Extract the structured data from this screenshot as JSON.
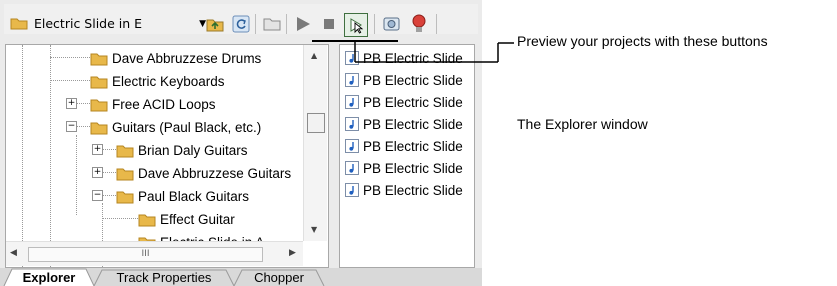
{
  "toolbar": {
    "folder_combo_value": "Electric Slide in E"
  },
  "tree": {
    "items": [
      {
        "label": "Dave Abbruzzese Drums"
      },
      {
        "label": "Electric Keyboards"
      },
      {
        "label": "Free ACID Loops",
        "expander": "+"
      },
      {
        "label": "Guitars (Paul Black, etc.)",
        "expander": "−"
      },
      {
        "label": "Brian Daly Guitars",
        "expander": "+"
      },
      {
        "label": "Dave Abbruzzese Guitars",
        "expander": "+"
      },
      {
        "label": "Paul Black Guitars",
        "expander": "−"
      },
      {
        "label": "Effect Guitar"
      },
      {
        "label": "Electric Slide in A"
      }
    ],
    "hscroll_thumb_label": "III"
  },
  "files": {
    "items": [
      {
        "label": "PB Electric Slide"
      },
      {
        "label": "PB Electric Slide"
      },
      {
        "label": "PB Electric Slide"
      },
      {
        "label": "PB Electric Slide"
      },
      {
        "label": "PB Electric Slide"
      },
      {
        "label": "PB Electric Slide"
      },
      {
        "label": "PB Electric Slide"
      }
    ]
  },
  "tabs": [
    {
      "label": "Explorer",
      "active": true
    },
    {
      "label": "Track Properties"
    },
    {
      "label": "Chopper"
    }
  ],
  "callouts": {
    "preview": "Preview your projects with these buttons",
    "explorer": "The Explorer window"
  },
  "colors": {
    "folder": "#e8b84a",
    "note_icon": "#1f5fbf",
    "play_icon": "#7a7a7a"
  }
}
